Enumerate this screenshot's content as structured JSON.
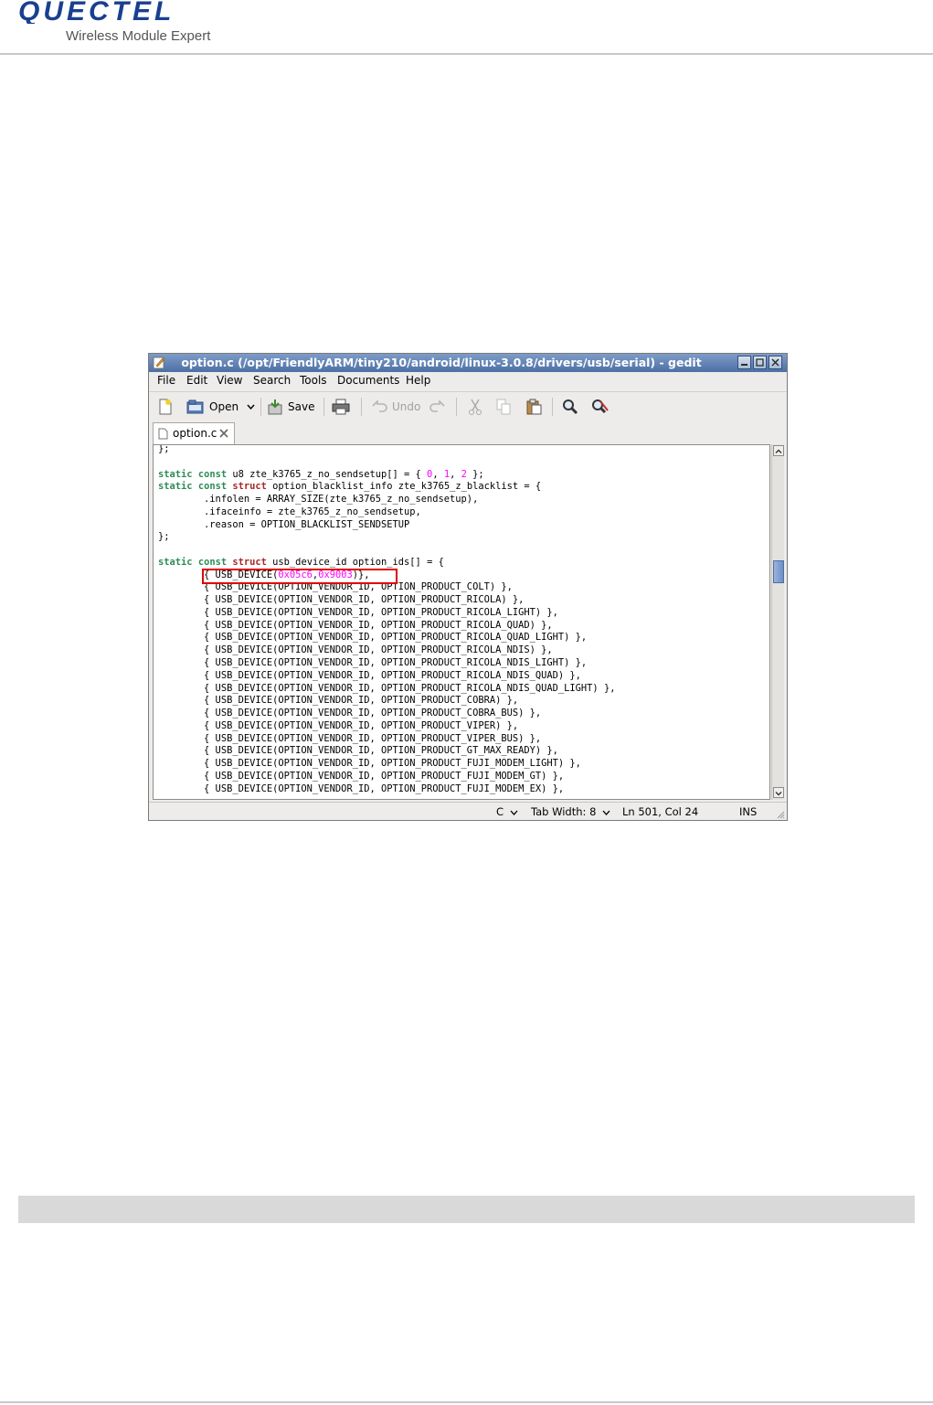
{
  "header": {
    "logo_text": "QUECTEL",
    "tagline": "Wireless Module Expert"
  },
  "window": {
    "title": "option.c (/opt/FriendlyARM/tiny210/android/linux-3.0.8/drivers/usb/serial) - gedit",
    "menu": [
      "File",
      "Edit",
      "View",
      "Search",
      "Tools",
      "Documents",
      "Help"
    ],
    "toolbar": {
      "open_label": "Open",
      "save_label": "Save",
      "undo_label": "Undo"
    },
    "tab_label": "option.c",
    "status": {
      "language": "C",
      "tab_width": "Tab Width:  8",
      "position": "Ln 501, Col 24",
      "mode": "INS"
    }
  },
  "code_lines": [
    [
      {
        "t": "};"
      }
    ],
    [
      {
        "t": ""
      }
    ],
    [
      {
        "t": "static",
        "c": "kw-g"
      },
      {
        "t": " "
      },
      {
        "t": "const",
        "c": "kw-g"
      },
      {
        "t": " u8 zte_k3765_z_no_sendsetup[] = { "
      },
      {
        "t": "0",
        "c": "num"
      },
      {
        "t": ", "
      },
      {
        "t": "1",
        "c": "num"
      },
      {
        "t": ", "
      },
      {
        "t": "2",
        "c": "num"
      },
      {
        "t": " };"
      }
    ],
    [
      {
        "t": "static",
        "c": "kw-g"
      },
      {
        "t": " "
      },
      {
        "t": "const",
        "c": "kw-g"
      },
      {
        "t": " "
      },
      {
        "t": "struct",
        "c": "kw-r"
      },
      {
        "t": " option_blacklist_info zte_k3765_z_blacklist = {"
      }
    ],
    [
      {
        "t": "        .infolen = ARRAY_SIZE(zte_k3765_z_no_sendsetup),"
      }
    ],
    [
      {
        "t": "        .ifaceinfo = zte_k3765_z_no_sendsetup,"
      }
    ],
    [
      {
        "t": "        .reason = OPTION_BLACKLIST_SENDSETUP"
      }
    ],
    [
      {
        "t": "};"
      }
    ],
    [
      {
        "t": ""
      }
    ],
    [
      {
        "t": "static",
        "c": "kw-g"
      },
      {
        "t": " "
      },
      {
        "t": "const",
        "c": "kw-g"
      },
      {
        "t": " "
      },
      {
        "t": "struct",
        "c": "kw-r"
      },
      {
        "t": " usb_device_id option_ids[] = {"
      }
    ],
    [
      {
        "t": "        { USB_DEVICE("
      },
      {
        "t": "0x05c6",
        "c": "num"
      },
      {
        "t": ","
      },
      {
        "t": "0x9003",
        "c": "num"
      },
      {
        "t": ")},"
      }
    ],
    [
      {
        "t": "        { USB_DEVICE(OPTION_VENDOR_ID, OPTION_PRODUCT_COLT) },"
      }
    ],
    [
      {
        "t": "        { USB_DEVICE(OPTION_VENDOR_ID, OPTION_PRODUCT_RICOLA) },"
      }
    ],
    [
      {
        "t": "        { USB_DEVICE(OPTION_VENDOR_ID, OPTION_PRODUCT_RICOLA_LIGHT) },"
      }
    ],
    [
      {
        "t": "        { USB_DEVICE(OPTION_VENDOR_ID, OPTION_PRODUCT_RICOLA_QUAD) },"
      }
    ],
    [
      {
        "t": "        { USB_DEVICE(OPTION_VENDOR_ID, OPTION_PRODUCT_RICOLA_QUAD_LIGHT) },"
      }
    ],
    [
      {
        "t": "        { USB_DEVICE(OPTION_VENDOR_ID, OPTION_PRODUCT_RICOLA_NDIS) },"
      }
    ],
    [
      {
        "t": "        { USB_DEVICE(OPTION_VENDOR_ID, OPTION_PRODUCT_RICOLA_NDIS_LIGHT) },"
      }
    ],
    [
      {
        "t": "        { USB_DEVICE(OPTION_VENDOR_ID, OPTION_PRODUCT_RICOLA_NDIS_QUAD) },"
      }
    ],
    [
      {
        "t": "        { USB_DEVICE(OPTION_VENDOR_ID, OPTION_PRODUCT_RICOLA_NDIS_QUAD_LIGHT) },"
      }
    ],
    [
      {
        "t": "        { USB_DEVICE(OPTION_VENDOR_ID, OPTION_PRODUCT_COBRA) },"
      }
    ],
    [
      {
        "t": "        { USB_DEVICE(OPTION_VENDOR_ID, OPTION_PRODUCT_COBRA_BUS) },"
      }
    ],
    [
      {
        "t": "        { USB_DEVICE(OPTION_VENDOR_ID, OPTION_PRODUCT_VIPER) },"
      }
    ],
    [
      {
        "t": "        { USB_DEVICE(OPTION_VENDOR_ID, OPTION_PRODUCT_VIPER_BUS) },"
      }
    ],
    [
      {
        "t": "        { USB_DEVICE(OPTION_VENDOR_ID, OPTION_PRODUCT_GT_MAX_READY) },"
      }
    ],
    [
      {
        "t": "        { USB_DEVICE(OPTION_VENDOR_ID, OPTION_PRODUCT_FUJI_MODEM_LIGHT) },"
      }
    ],
    [
      {
        "t": "        { USB_DEVICE(OPTION_VENDOR_ID, OPTION_PRODUCT_FUJI_MODEM_GT) },"
      }
    ],
    [
      {
        "t": "        { USB_DEVICE(OPTION_VENDOR_ID, OPTION_PRODUCT_FUJI_MODEM_EX) },"
      }
    ]
  ],
  "colors": {
    "keyword_type": "#2e8b57",
    "keyword_struct": "#a52a2a",
    "number": "#ff00ff",
    "highlight_box": "#e00000",
    "titlebar": "#4c6fa5"
  }
}
